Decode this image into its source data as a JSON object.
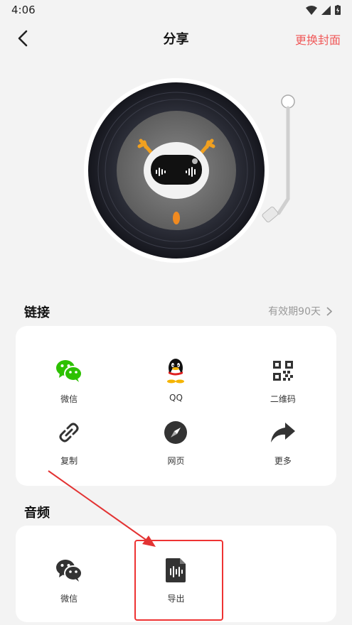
{
  "status_bar": {
    "time": "4:06"
  },
  "header": {
    "title": "分享",
    "action_label": "更换封面"
  },
  "link_section": {
    "title": "链接",
    "validity": "有效期90天",
    "items": [
      {
        "label": "微信",
        "icon": "wechat-icon"
      },
      {
        "label": "QQ",
        "icon": "qq-icon"
      },
      {
        "label": "二维码",
        "icon": "qrcode-icon"
      },
      {
        "label": "复制",
        "icon": "link-icon"
      },
      {
        "label": "网页",
        "icon": "compass-icon"
      },
      {
        "label": "更多",
        "icon": "share-forward-icon"
      }
    ]
  },
  "audio_section": {
    "title": "音频",
    "items": [
      {
        "label": "微信",
        "icon": "wechat-icon"
      },
      {
        "label": "导出",
        "icon": "audio-file-icon"
      }
    ]
  },
  "colors": {
    "accent": "#f05a5a",
    "wechat_green": "#2dc100",
    "highlight": "#e33333"
  }
}
